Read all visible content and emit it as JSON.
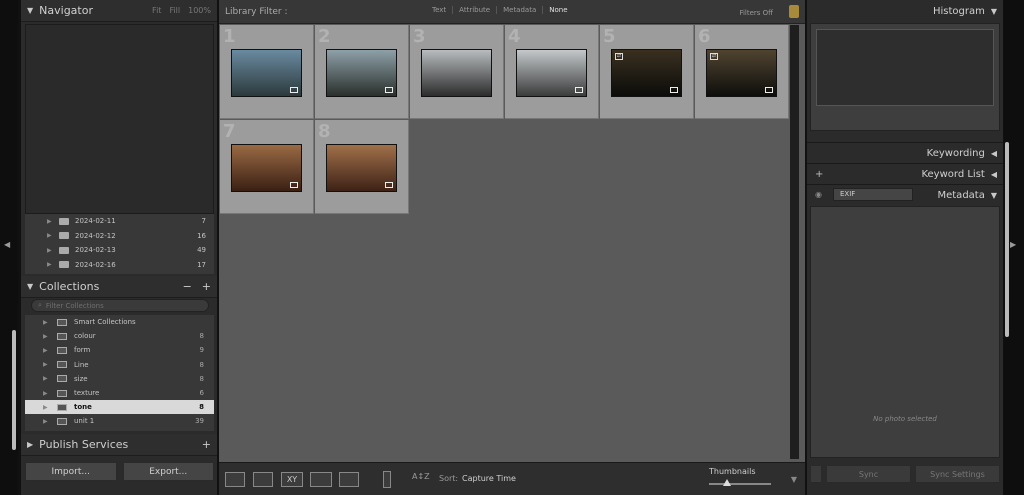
{
  "left_panel": {
    "navigator": {
      "title": "Navigator",
      "zoom_options": [
        "Fit",
        "Fill",
        "100%"
      ]
    },
    "folders": [
      {
        "name": "2024-02-11",
        "count": "7"
      },
      {
        "name": "2024-02-12",
        "count": "16"
      },
      {
        "name": "2024-02-13",
        "count": "49"
      },
      {
        "name": "2024-02-16",
        "count": "17"
      }
    ],
    "collections": {
      "title": "Collections",
      "search_placeholder": "Filter Collections",
      "items": [
        {
          "name": "Smart Collections",
          "count": ""
        },
        {
          "name": "colour",
          "count": "8"
        },
        {
          "name": "form",
          "count": "9"
        },
        {
          "name": "Line",
          "count": "8"
        },
        {
          "name": "size",
          "count": "8"
        },
        {
          "name": "texture",
          "count": "6"
        },
        {
          "name": "tone",
          "count": "8",
          "selected": true
        },
        {
          "name": "unit 1",
          "count": "39"
        }
      ]
    },
    "publish_services": {
      "title": "Publish Services",
      "add": "+"
    },
    "buttons": {
      "import": "Import...",
      "export": "Export..."
    }
  },
  "filter_bar": {
    "title": "Library Filter :",
    "tabs": [
      "Text",
      "Attribute",
      "Metadata",
      "None"
    ],
    "active_tab": "None",
    "filters_off": "Filters Off"
  },
  "grid": {
    "cells": [
      {
        "number": "1",
        "colors": [
          "#6a8aa0",
          "#2c3a3c"
        ]
      },
      {
        "number": "2",
        "colors": [
          "#8ea0a8",
          "#2a302c"
        ]
      },
      {
        "number": "3",
        "colors": [
          "#b8bcbe",
          "#2c2c2c"
        ]
      },
      {
        "number": "4",
        "colors": [
          "#c4c8ca",
          "#3a3c3c"
        ]
      },
      {
        "number": "5",
        "colors": [
          "#3a3020",
          "#0c0c0a"
        ]
      },
      {
        "number": "6",
        "colors": [
          "#504430",
          "#0e0e0c"
        ]
      },
      {
        "number": "7",
        "colors": [
          "#9a6a44",
          "#3a2014"
        ]
      },
      {
        "number": "8",
        "colors": [
          "#a0704a",
          "#3e2216"
        ]
      }
    ]
  },
  "toolbar": {
    "sort_label": "Sort:",
    "sort_value": "Capture Time",
    "thumbnails_label": "Thumbnails"
  },
  "right_panel": {
    "histogram": "Histogram",
    "keywording": "Keywording",
    "keyword_list": "Keyword List",
    "keyword_add": "+",
    "metadata": "Metadata",
    "metadata_preset": "EXIF",
    "no_photo": "No photo selected",
    "sync": "Sync",
    "sync_settings": "Sync Settings"
  }
}
